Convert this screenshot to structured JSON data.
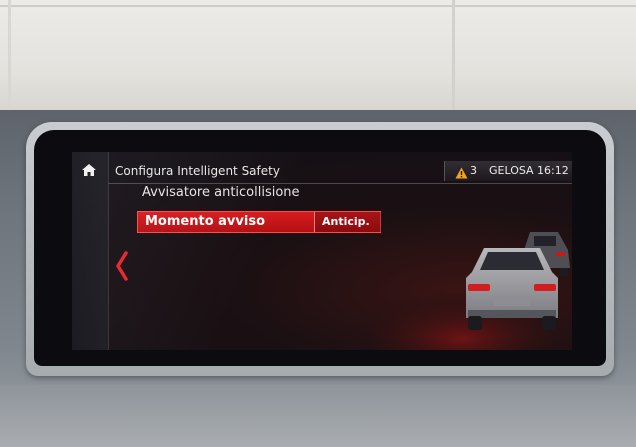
{
  "header": {
    "title": "Configura Intelligent Safety",
    "warning_count": "3",
    "location": "GELOSA",
    "time": "16:12"
  },
  "section": {
    "title": "Avvisatore anticollisione"
  },
  "menu": {
    "item_label": "Momento avviso",
    "item_value": "Anticip."
  },
  "icons": {
    "home": "home-icon",
    "back": "chevron-left-icon",
    "warning": "warning-triangle-icon"
  },
  "colors": {
    "accent": "#d81c1f",
    "warning": "#f3a31c",
    "screen_bg": "#121118"
  }
}
